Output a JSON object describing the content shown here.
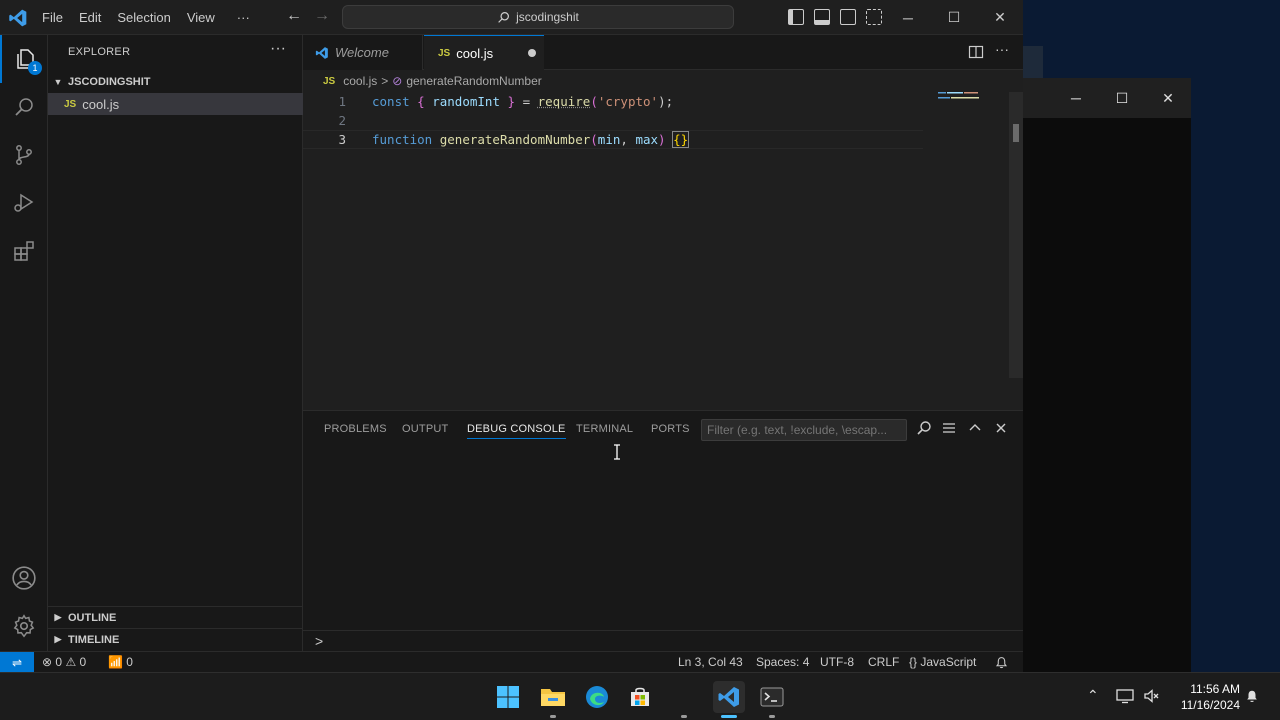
{
  "menu": {
    "file": "File",
    "edit": "Edit",
    "selection": "Selection",
    "view": "View",
    "more": "···"
  },
  "command_center": {
    "text": "jscodingshit"
  },
  "activity": {
    "explorer_badge": "1"
  },
  "sidebar": {
    "title": "EXPLORER",
    "more": "···",
    "folder": "JSCODINGSHIT",
    "file": {
      "icon_text": "JS",
      "name": "cool.js"
    },
    "outline": "OUTLINE",
    "timeline": "TIMELINE"
  },
  "tabs": [
    {
      "label": "Welcome"
    },
    {
      "icon_text": "JS",
      "label": "cool.js"
    }
  ],
  "breadcrumb": {
    "file_icon": "JS",
    "file": "cool.js",
    "separator": ">",
    "symbol": "generateRandomNumber"
  },
  "editor": {
    "line_numbers": [
      "1",
      "2",
      "3"
    ],
    "line1": {
      "kw": "const",
      "open": "{",
      "name": "randomInt",
      "close": "}",
      "eq": "=",
      "fn": "require",
      "lp": "(",
      "str": "'crypto'",
      "rp": ");"
    },
    "line3": {
      "kw": "function",
      "fn": "generateRandomNumber",
      "lp": "(",
      "p1": "min",
      "comma": ",",
      "p2": "max",
      "rp": ")",
      "body": "{}"
    }
  },
  "panel": {
    "tabs": [
      "PROBLEMS",
      "OUTPUT",
      "DEBUG CONSOLE",
      "TERMINAL",
      "PORTS"
    ],
    "active_tab": "DEBUG CONSOLE",
    "filter_placeholder": "Filter (e.g. text, !exclude, \\escap...",
    "prompt": ">"
  },
  "statusbar": {
    "errors": "0",
    "warnings": "0",
    "ports": "0",
    "position": "Ln 3, Col 43",
    "spaces": "Spaces: 4",
    "encoding": "UTF-8",
    "eol": "CRLF",
    "language_icon": "{}",
    "language": "JavaScript"
  },
  "taskbar": {
    "time": "11:56 AM",
    "date": "11/16/2024"
  },
  "colors": {
    "accent": "#0078d4",
    "editor_bg": "#1f1f1f",
    "sidebar_bg": "#181818",
    "js_icon": "#cbcb41"
  },
  "icons": [
    "vscode-logo-icon",
    "files-icon",
    "search-icon",
    "source-control-icon",
    "run-debug-icon",
    "extensions-icon",
    "account-icon",
    "settings-gear-icon",
    "split-editor-icon",
    "close-panel-icon",
    "maximize-panel-icon",
    "windows-start-icon",
    "file-explorer-icon",
    "edge-icon",
    "store-icon",
    "terminal-icon",
    "bell-icon"
  ]
}
